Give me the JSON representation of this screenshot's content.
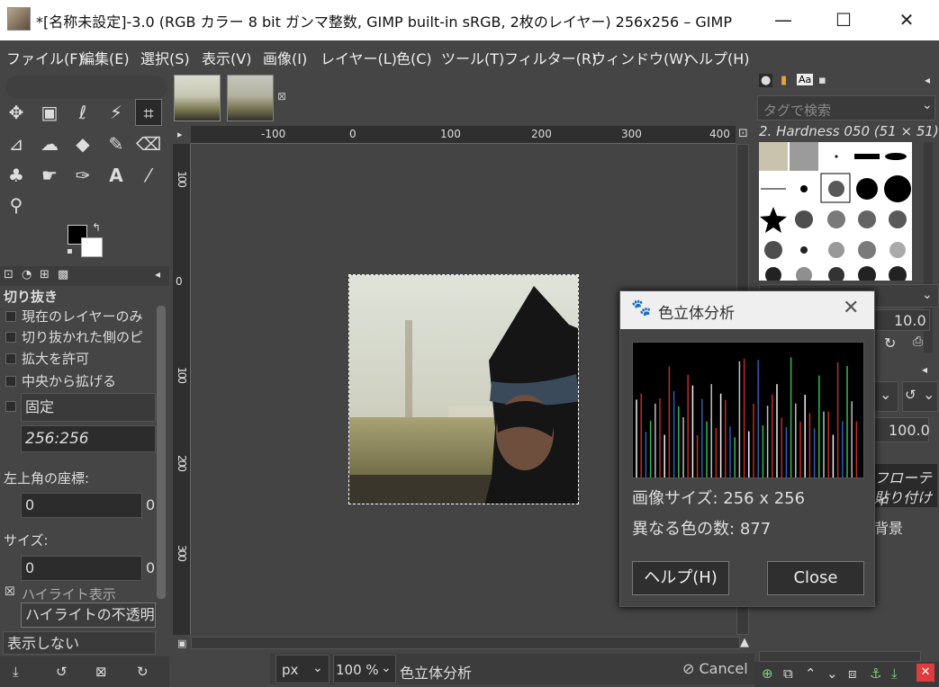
{
  "window": {
    "title": "*[名称未設定]-3.0 (RGB カラー 8 bit ガンマ整数, GIMP built-in sRGB, 2枚のレイヤー) 256x256 – GIMP",
    "minimize": "—",
    "maximize": "☐",
    "close": "✕"
  },
  "menu": [
    "ファイル(F)",
    "編集(E)",
    "選択(S)",
    "表示(V)",
    "画像(I)",
    "レイヤー(L)",
    "色(C)",
    "ツール(T)",
    "フィルター(R)",
    "ウィンドウ(W)",
    "ヘルプ(H)"
  ],
  "tool_options": {
    "title": "切り抜き",
    "current_layer_only": "現在のレイヤーのみ",
    "delete_cropped": "切り抜かれた側のピ",
    "allow_growing": "拡大を許可",
    "expand_from_center": "中央から拡げる",
    "fixed": "固定",
    "aspect_value": "256:256",
    "position_label": "左上角の座標:",
    "position_x": "0",
    "position_y_partial": "0",
    "size_label": "サイズ:",
    "size_w": "0",
    "size_h_partial": "0",
    "highlight": "ハイライト表示",
    "highlight_opacity": "ハイライトの不透明",
    "guides_value": "表示しない"
  },
  "rulers": {
    "h": [
      "-100",
      "0",
      "100",
      "200",
      "300",
      "400"
    ],
    "v": [
      "100",
      "0",
      "100",
      "200",
      "300"
    ]
  },
  "statusbar": {
    "unit": "px",
    "zoom": "100 %",
    "message": "色立体分析",
    "cancel": "Cancel"
  },
  "right_dock": {
    "tag_search_placeholder": "タグで検索",
    "brush_name": "2. Hardness 050 (51 × 51)",
    "spacing_value": "10.0",
    "opacity_value": "100.0",
    "layer1_partial": "フローティ",
    "layer1_sub_partial": "貼り付け",
    "layer2_partial": "背景"
  },
  "dialog": {
    "title": "色立体分析",
    "image_size_label": "画像サイズ:",
    "image_size_value": "256 x 256",
    "colors_label": "異なる色の数:",
    "colors_value": "877",
    "help_button": "ヘルプ(H)",
    "close_button": "Close"
  }
}
